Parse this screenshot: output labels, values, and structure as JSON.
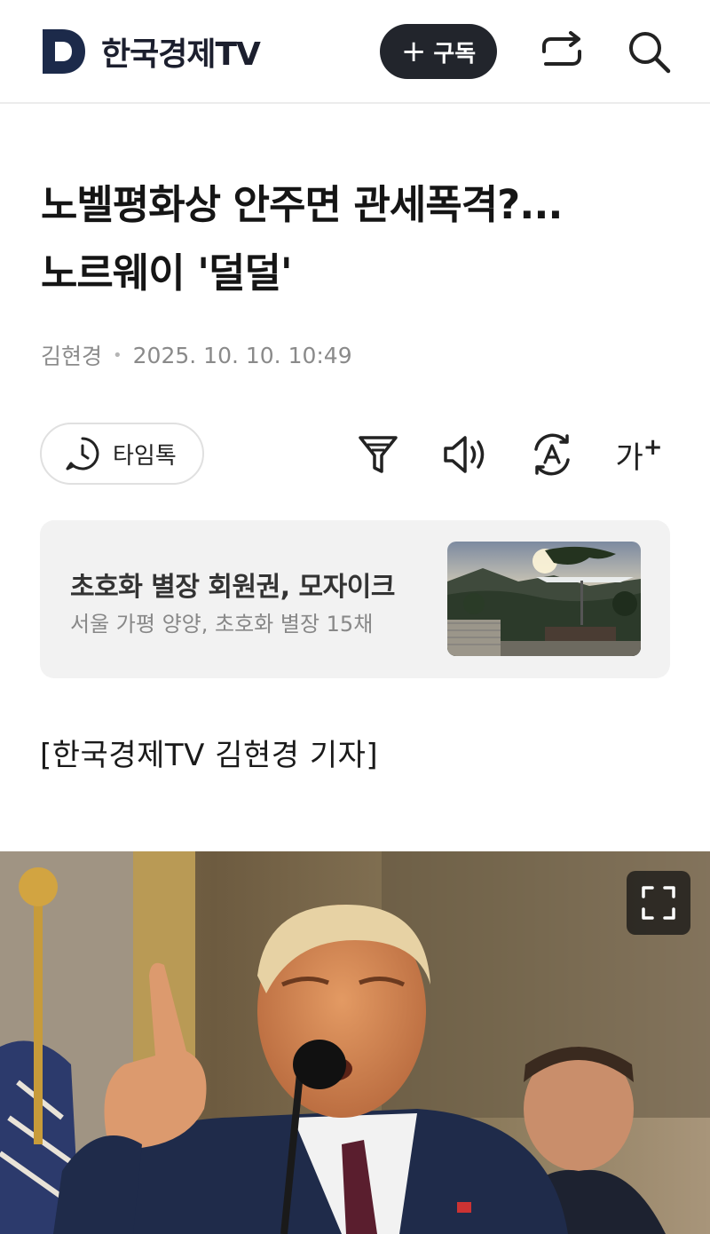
{
  "header": {
    "logo_text": "한국경제TV",
    "subscribe_label": "구독",
    "subscribe_icon": "plus-icon",
    "share_icon": "share-icon",
    "search_icon": "search-icon",
    "brand_color": "#1c1f2e"
  },
  "article": {
    "title_line1": "노벨평화상 안주면 관세폭격?...",
    "title_line2": "노르웨이 '덜덜'",
    "author": "김현경",
    "date": "2025. 10. 10. 10:49",
    "byline": "[한국경제TV 김현경 기자]"
  },
  "toolbar": {
    "timetalk_label": "타임톡",
    "timetalk_icon": "clock-chat-icon",
    "filter_icon": "filter-icon",
    "audio_icon": "speaker-icon",
    "translate_icon": "translate-icon",
    "font_label": "가",
    "font_plus": "+"
  },
  "promo": {
    "title": "초호화 별장 회원권, 모자이크",
    "subtitle": "서울 가평 양양, 초호화 별장 15채"
  },
  "photo": {
    "expand_icon": "expand-icon"
  }
}
